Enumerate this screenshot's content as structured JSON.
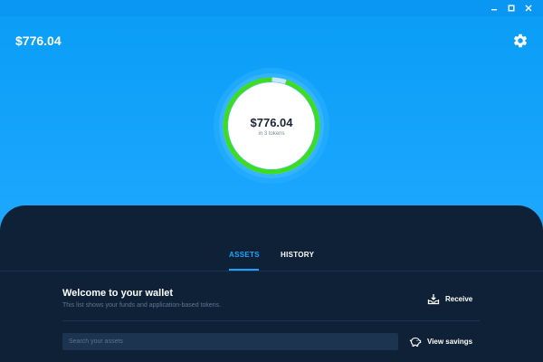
{
  "window": {
    "minimize_icon": "minimize-icon",
    "maximize_icon": "maximize-icon",
    "close_icon": "close-icon"
  },
  "header": {
    "balance": "$776.04",
    "settings_icon": "gear-icon"
  },
  "summary": {
    "amount": "$776.04",
    "subtitle": "in 3 tokens",
    "ring_fill_fraction": 0.95,
    "ring_color": "#3ddc1e"
  },
  "tabs": [
    {
      "label": "ASSETS",
      "active": true
    },
    {
      "label": "HISTORY",
      "active": false
    }
  ],
  "wallet": {
    "title": "Welcome to your wallet",
    "subtitle": "This list shows your funds and application-based tokens.",
    "receive_label": "Receive",
    "receive_icon": "inbox-download-icon",
    "search_placeholder": "Search your assets",
    "savings_label": "View savings",
    "savings_icon": "piggy-bank-icon"
  },
  "colors": {
    "accent": "#1ba4ff",
    "header_bg": "#0a9bf5",
    "panel_bg": "#0f2137"
  }
}
